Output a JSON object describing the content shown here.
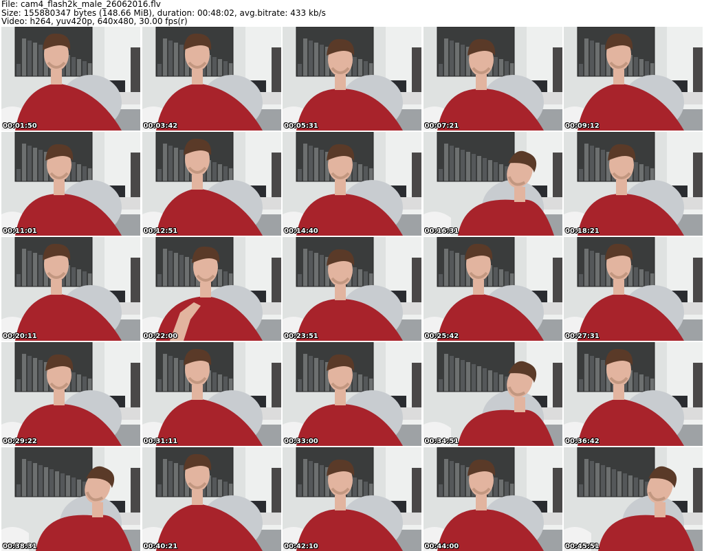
{
  "header": {
    "file_line": "File: cam4_flash2k_male_26062016.flv",
    "size_line": "Size: 155880347 bytes (148.66 MiB), duration: 00:48:02, avg.bitrate: 433 kb/s",
    "video_line": "Video: h264, yuv420p, 640x480, 30.00 fps(r)"
  },
  "colors": {
    "wall": "#dfe2e1",
    "poster": "#3a3c3c",
    "shirt": "#a8232b",
    "skin": "#e2b49f",
    "hair": "#5a3a28",
    "chair": "#c8ccd0",
    "timestamp_text": "#ffffff",
    "timestamp_outline": "#000000"
  },
  "thumbnails": [
    {
      "timestamp": "00:01:50",
      "pose": "upright"
    },
    {
      "timestamp": "00:03:42",
      "pose": "upright"
    },
    {
      "timestamp": "00:05:31",
      "pose": "looking-down"
    },
    {
      "timestamp": "00:07:21",
      "pose": "looking-down"
    },
    {
      "timestamp": "00:09:12",
      "pose": "upright"
    },
    {
      "timestamp": "00:11:01",
      "pose": "looking-down"
    },
    {
      "timestamp": "00:12:51",
      "pose": "upright"
    },
    {
      "timestamp": "00:14:40",
      "pose": "looking-down"
    },
    {
      "timestamp": "00:16:31",
      "pose": "leaning"
    },
    {
      "timestamp": "00:18:21",
      "pose": "looking-down"
    },
    {
      "timestamp": "00:20:11",
      "pose": "upright"
    },
    {
      "timestamp": "00:22:00",
      "pose": "hand-raised"
    },
    {
      "timestamp": "00:23:51",
      "pose": "looking-down"
    },
    {
      "timestamp": "00:25:42",
      "pose": "upright"
    },
    {
      "timestamp": "00:27:31",
      "pose": "upright"
    },
    {
      "timestamp": "00:29:22",
      "pose": "looking-down"
    },
    {
      "timestamp": "00:31:11",
      "pose": "upright"
    },
    {
      "timestamp": "00:33:00",
      "pose": "looking-down"
    },
    {
      "timestamp": "00:34:51",
      "pose": "leaning"
    },
    {
      "timestamp": "00:36:42",
      "pose": "upright"
    },
    {
      "timestamp": "00:38:31",
      "pose": "leaning"
    },
    {
      "timestamp": "00:40:21",
      "pose": "upright"
    },
    {
      "timestamp": "00:42:10",
      "pose": "looking-down"
    },
    {
      "timestamp": "00:44:00",
      "pose": "looking-down"
    },
    {
      "timestamp": "00:45:51",
      "pose": "leaning"
    }
  ]
}
